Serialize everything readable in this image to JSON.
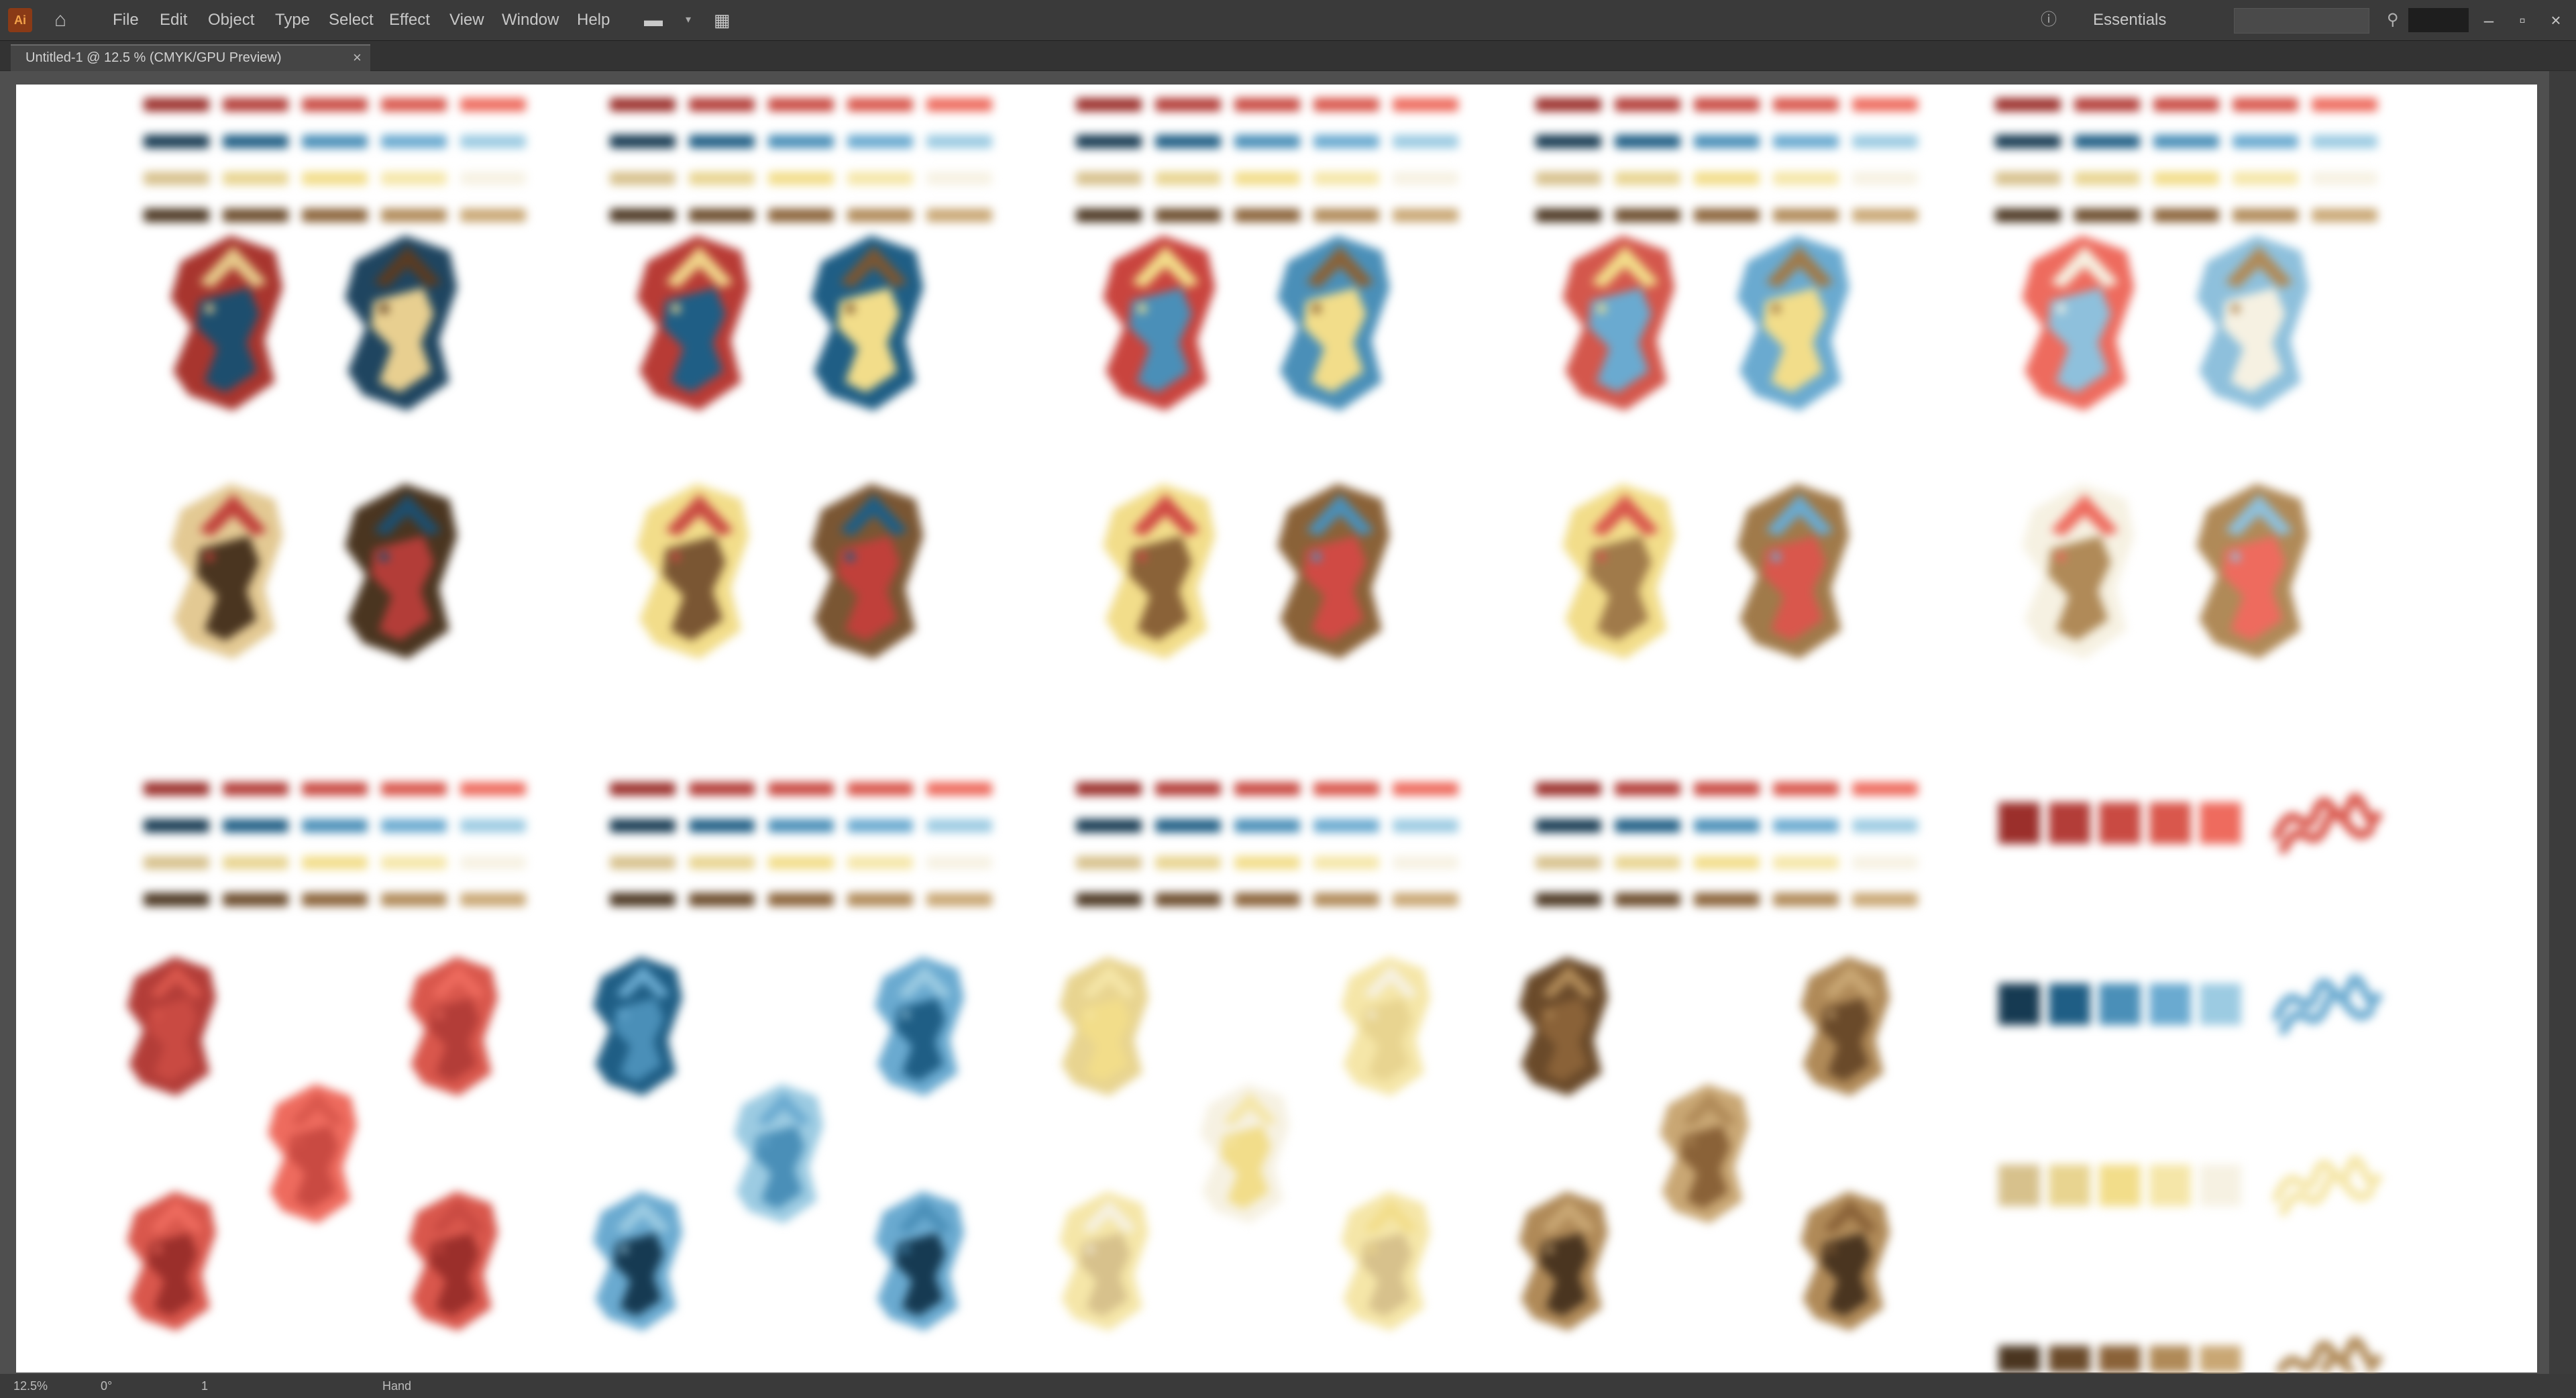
{
  "app": {
    "logo_text": "Ai",
    "home_icon": "home-icon"
  },
  "menu": [
    "File",
    "Edit",
    "Object",
    "Type",
    "Select",
    "Effect",
    "View",
    "Window",
    "Help"
  ],
  "toolbar": {
    "workspace_icon": "workspace-icon",
    "arrange_icon": "arrange-documents-icon"
  },
  "header_right": {
    "workspace_label": "Essentials",
    "search_placeholder": "",
    "window_buttons": [
      "minimize",
      "maximize",
      "close"
    ]
  },
  "document_tab": {
    "title": "Untitled-1 @ 12.5 % (CMYK/GPU Preview)",
    "close_glyph": "×"
  },
  "statusbar": {
    "zoom": "12.5%",
    "angle": "0°",
    "artboard": "1",
    "tool": "Hand"
  },
  "palette_colors": {
    "reds": [
      "#9b2f2b",
      "#b33d38",
      "#c94a42",
      "#d9574c",
      "#ee6b5e"
    ],
    "blues": [
      "#163a52",
      "#1f5e85",
      "#4a8fb8",
      "#6aaad0",
      "#9ccbe2"
    ],
    "yellows": [
      "#d7c18c",
      "#e8d490",
      "#f2dd8a",
      "#f5e6a8",
      "#f6f1e2"
    ],
    "browns": [
      "#4a3520",
      "#6a4a2a",
      "#8a6238",
      "#b08a58",
      "#c9a774"
    ]
  },
  "swatch_rows_order": [
    "reds",
    "blues",
    "yellows",
    "browns"
  ],
  "shape_color_sets": [
    {
      "topL": [
        "#a8352e",
        "#1d4e6e",
        "#e6c98a"
      ],
      "topR": [
        "#1f4560",
        "#e8cf90",
        "#5a3b22"
      ],
      "botL": [
        "#e3c993",
        "#4a3520",
        "#c0403a"
      ],
      "botR": [
        "#4a3520",
        "#b33d38",
        "#1d4e6e"
      ]
    },
    {
      "topL": [
        "#b83b35",
        "#1f5e85",
        "#f0d48a"
      ],
      "topR": [
        "#1f5e85",
        "#f2dd8a",
        "#7a5633"
      ],
      "botL": [
        "#f2dd8a",
        "#7a5633",
        "#c94a42"
      ],
      "botR": [
        "#7a5633",
        "#c0403a",
        "#1f5e85"
      ]
    },
    {
      "topL": [
        "#c9443e",
        "#4a8fb8",
        "#f2dd8a"
      ],
      "topR": [
        "#4a8fb8",
        "#f2dd8a",
        "#8a6238"
      ],
      "botL": [
        "#f2dd8a",
        "#8a6238",
        "#d04a44"
      ],
      "botR": [
        "#8a6238",
        "#d04a44",
        "#4a8fb8"
      ]
    },
    {
      "topL": [
        "#d4574c",
        "#6aaad0",
        "#f2dd8a"
      ],
      "topR": [
        "#6aaad0",
        "#f2dd8a",
        "#a07a4a"
      ],
      "botL": [
        "#f2dd8a",
        "#a07a4a",
        "#d9574c"
      ],
      "botR": [
        "#a07a4a",
        "#d9574c",
        "#6aaad0"
      ]
    },
    {
      "topL": [
        "#ee6b5e",
        "#8ec0dc",
        "#f6f1e2"
      ],
      "topR": [
        "#8ec0dc",
        "#f6f1e2",
        "#b08a58"
      ],
      "botL": [
        "#f6f1e2",
        "#b08a58",
        "#ee6b5e"
      ],
      "botR": [
        "#b08a58",
        "#ee6b5e",
        "#8ec0dc"
      ]
    }
  ],
  "mono_groups": [
    "reds",
    "blues",
    "yellows",
    "browns"
  ],
  "legend_rows": [
    "reds",
    "blues",
    "yellows",
    "browns"
  ]
}
